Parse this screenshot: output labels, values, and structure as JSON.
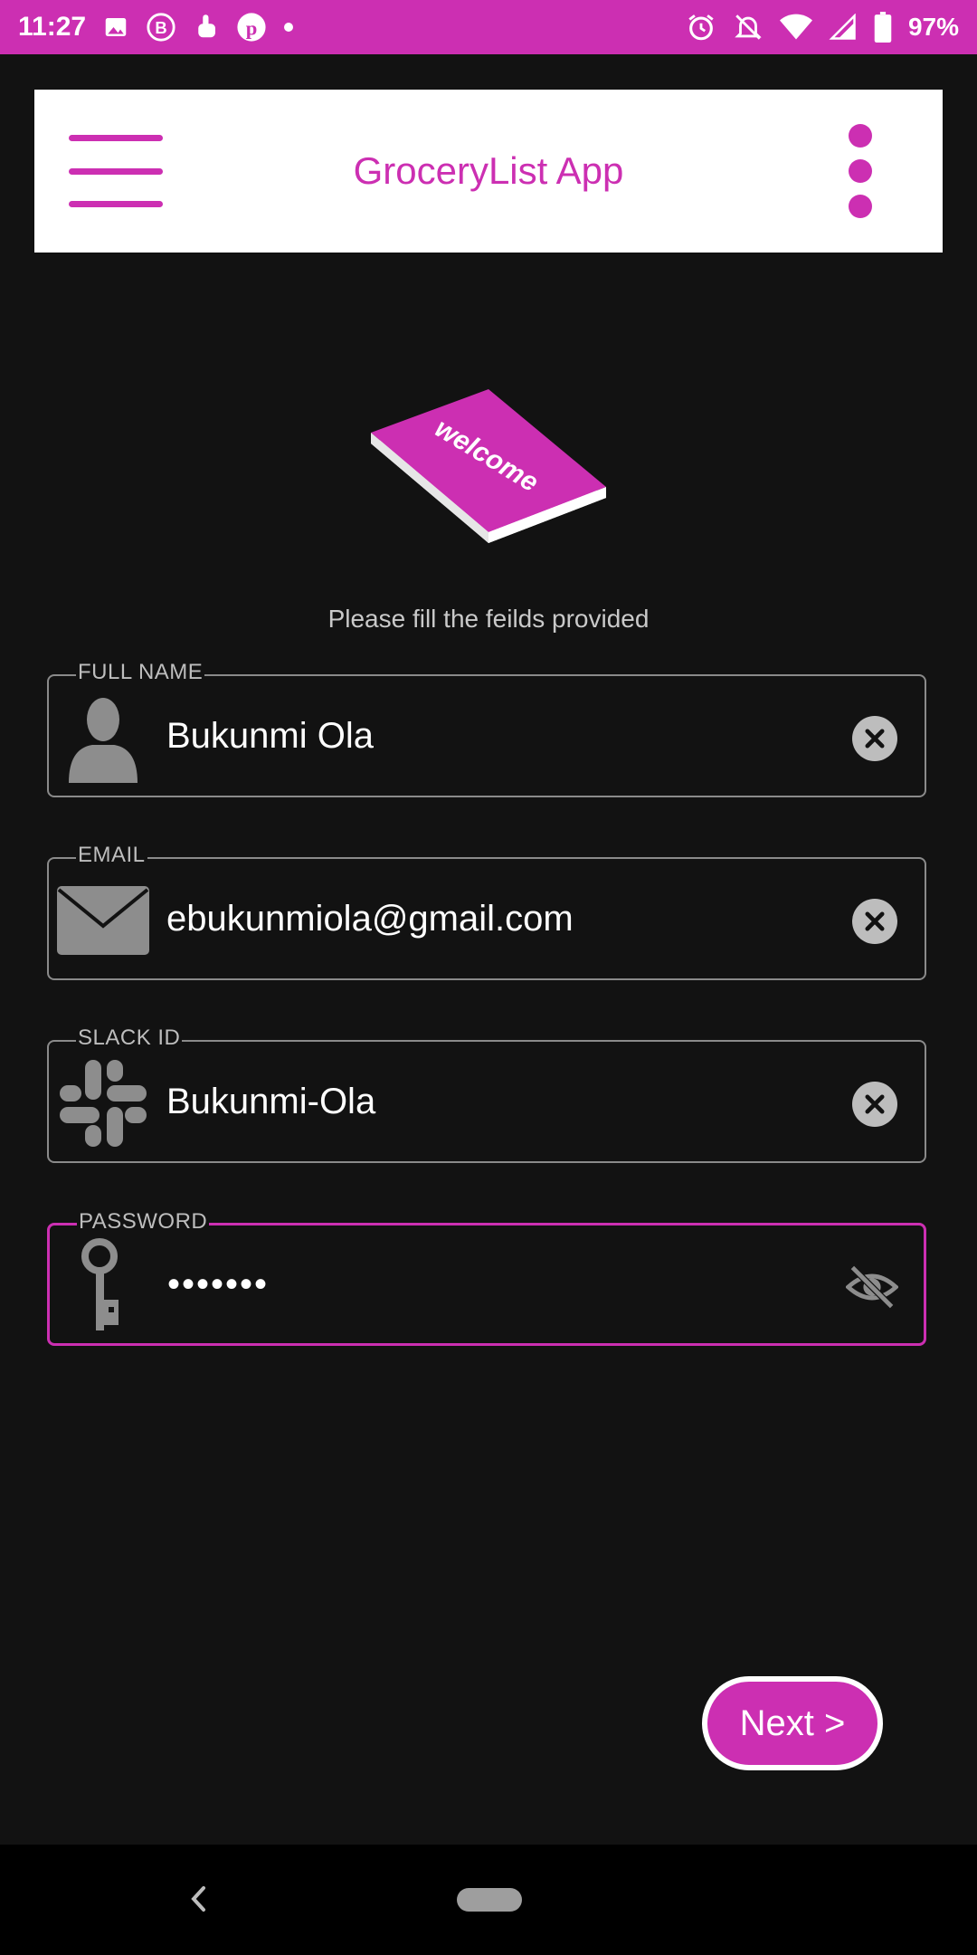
{
  "status_bar": {
    "time": "11:27",
    "battery": "97%",
    "left_icons": [
      "image-icon",
      "b-badge-icon",
      "touch-icon",
      "pinterest-icon",
      "dot-icon"
    ],
    "right_icons": [
      "alarm-icon",
      "notifications-off-icon",
      "wifi-icon",
      "signal-icon",
      "battery-icon"
    ]
  },
  "app_bar": {
    "title": "GroceryList App",
    "menu_icon": "hamburger-menu-icon",
    "more_icon": "more-vert-icon"
  },
  "illustration": {
    "text": "welcome"
  },
  "instruction": "Please fill the feilds provided",
  "fields": {
    "full_name": {
      "label": "FULL NAME",
      "value": "Bukunmi Ola",
      "icon": "person-icon"
    },
    "email": {
      "label": "EMAIL",
      "value": "ebukunmiola@gmail.com",
      "icon": "mail-icon"
    },
    "slack_id": {
      "label": "SLACK ID",
      "value": "Bukunmi-Ola",
      "icon": "slack-icon"
    },
    "password": {
      "label": "PASSWORD",
      "value": "•••••••",
      "icon": "key-icon"
    }
  },
  "next_button": "Next >",
  "colors": {
    "accent": "#cc2fb2",
    "background": "#121212",
    "field_border": "#8a8a8a"
  }
}
